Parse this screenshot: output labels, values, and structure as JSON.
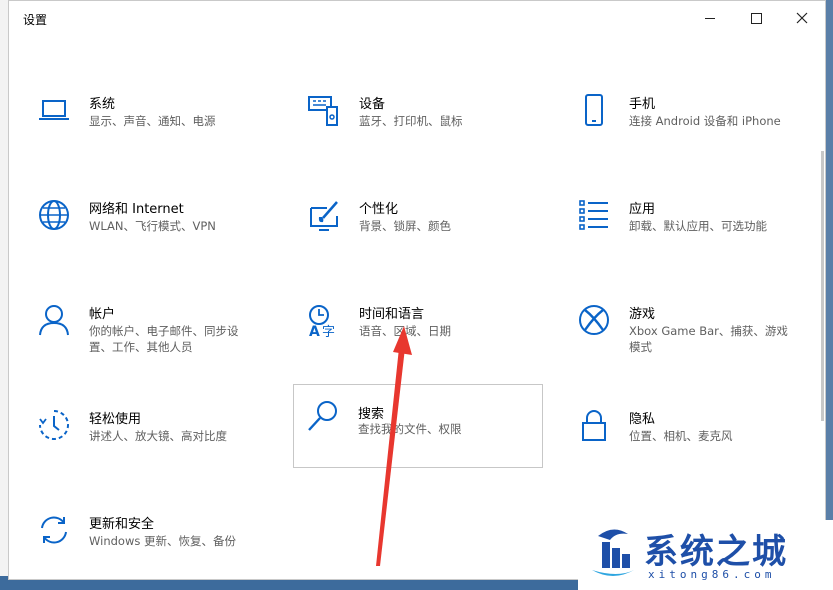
{
  "window": {
    "title": "设置"
  },
  "tiles": [
    {
      "title": "系统",
      "desc": "显示、声音、通知、电源"
    },
    {
      "title": "设备",
      "desc": "蓝牙、打印机、鼠标"
    },
    {
      "title": "手机",
      "desc": "连接 Android 设备和 iPhone"
    },
    {
      "title": "网络和 Internet",
      "desc": "WLAN、飞行模式、VPN"
    },
    {
      "title": "个性化",
      "desc": "背景、锁屏、颜色"
    },
    {
      "title": "应用",
      "desc": "卸载、默认应用、可选功能"
    },
    {
      "title": "帐户",
      "desc": "你的帐户、电子邮件、同步设置、工作、其他人员"
    },
    {
      "title": "时间和语言",
      "desc": "语音、区域、日期"
    },
    {
      "title": "游戏",
      "desc": "Xbox Game Bar、捕获、游戏模式"
    },
    {
      "title": "轻松使用",
      "desc": "讲述人、放大镜、高对比度"
    },
    {
      "title": "搜索",
      "desc": "查找我的文件、权限"
    },
    {
      "title": "隐私",
      "desc": "位置、相机、麦克风"
    },
    {
      "title": "更新和安全",
      "desc": "Windows 更新、恢复、备份"
    }
  ],
  "icons": {
    "system": "laptop-icon",
    "devices": "keyboard-icon",
    "phone": "phone-icon",
    "network": "globe-icon",
    "personalization": "brush-icon",
    "apps": "apps-list-icon",
    "accounts": "person-icon",
    "time": "clock-language-icon",
    "gaming": "xbox-icon",
    "ease": "ease-of-access-icon",
    "search": "search-icon",
    "privacy": "lock-icon",
    "update": "sync-icon"
  },
  "colors": {
    "accent": "#0a64c8",
    "arrow": "#e8372f",
    "watermark": "#1e4fa8"
  },
  "watermark": {
    "name": "系统之城",
    "url": "xitong86.com"
  }
}
